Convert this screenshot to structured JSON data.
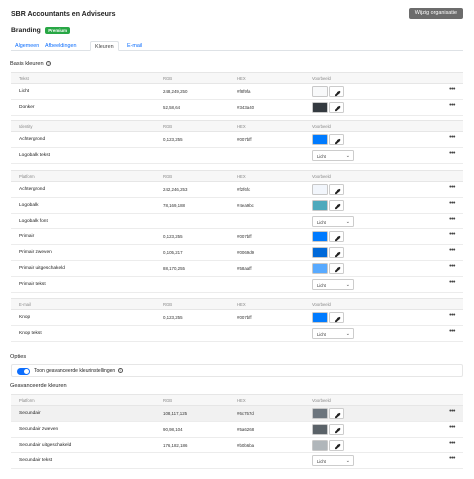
{
  "header": {
    "title": "SBR Accountants en Adviseurs",
    "edit_button": "Wijzig organisatie"
  },
  "branding": {
    "title": "Branding",
    "badge": "Premium"
  },
  "tabs": [
    {
      "label": "Algemeen",
      "active": false
    },
    {
      "label": "Afbeeldingen",
      "active": false
    },
    {
      "label": "Kleuren",
      "active": true
    },
    {
      "label": "E-mail",
      "active": false
    }
  ],
  "basic": {
    "title": "Basis kleuren"
  },
  "groups": [
    {
      "headers": [
        "Tekst",
        "RGB",
        "HEX",
        "Voorbeeld"
      ],
      "rows": [
        {
          "name": "Licht",
          "rgb": "248,249,250",
          "hex": "#f8f9fa",
          "color": "#f8f9fa",
          "kind": "color"
        },
        {
          "name": "Donker",
          "rgb": "52,58,64",
          "hex": "#343a40",
          "color": "#343a40",
          "kind": "color"
        }
      ]
    },
    {
      "headers": [
        "Identity",
        "RGB",
        "HEX",
        "Voorbeeld"
      ],
      "rows": [
        {
          "name": "Achtergrond",
          "rgb": "0,123,255",
          "hex": "#007bff",
          "color": "#007bff",
          "kind": "color"
        },
        {
          "name": "Logobalk tekst",
          "select": "Licht",
          "kind": "select"
        }
      ]
    },
    {
      "headers": [
        "Platform",
        "RGB",
        "HEX",
        "Voorbeeld"
      ],
      "rows": [
        {
          "name": "Achtergrond",
          "rgb": "242,246,253",
          "hex": "#f2f6fc",
          "color": "#f2f6fc",
          "kind": "color"
        },
        {
          "name": "Logobalk",
          "rgb": "78,169,188",
          "hex": "#4ea9bc",
          "color": "#4ea9bc",
          "kind": "color"
        },
        {
          "name": "Logobalk font",
          "select": "Licht",
          "kind": "select"
        },
        {
          "name": "Primair",
          "rgb": "0,123,255",
          "hex": "#007bff",
          "color": "#007bff",
          "kind": "color"
        },
        {
          "name": "Primair zweven",
          "rgb": "0,105,217",
          "hex": "#0069d9",
          "color": "#0069d9",
          "kind": "color"
        },
        {
          "name": "Primair uitgeschakeld",
          "rgb": "88,170,255",
          "hex": "#58aaff",
          "color": "#58aaff",
          "kind": "color"
        },
        {
          "name": "Primair tekst",
          "select": "Licht",
          "kind": "select"
        }
      ]
    },
    {
      "headers": [
        "E-mail",
        "RGB",
        "HEX",
        "Voorbeeld"
      ],
      "rows": [
        {
          "name": "Knop",
          "rgb": "0,123,255",
          "hex": "#007bff",
          "color": "#007bff",
          "kind": "color"
        },
        {
          "name": "Knop tekst",
          "select": "Licht",
          "kind": "select"
        }
      ]
    }
  ],
  "options": {
    "title": "Opties",
    "toggle_label": "Toon geavanceerde kleurinstellingen",
    "toggle_on": true
  },
  "advanced": {
    "title": "Geavanceerde kleuren",
    "headers": [
      "Platform",
      "RGB",
      "HEX",
      "Voorbeeld"
    ],
    "rows": [
      {
        "name": "Secundair",
        "rgb": "108,117,125",
        "hex": "#6c757d",
        "color": "#6c757d",
        "kind": "color"
      },
      {
        "name": "Secundair zweven",
        "rgb": "90,98,104",
        "hex": "#5a6268",
        "color": "#5a6268",
        "kind": "color"
      },
      {
        "name": "Secundair uitgeschakeld",
        "rgb": "176,182,186",
        "hex": "#b0b6ba",
        "color": "#b0b6ba",
        "kind": "color"
      },
      {
        "name": "Secundair tekst",
        "select": "Licht",
        "kind": "select"
      }
    ]
  },
  "icons": {
    "picker": "eyedropper-icon",
    "menu": "more-dots-icon",
    "chevron": "chevron-down-icon",
    "info": "info-icon"
  },
  "accent": "#0d6efd"
}
